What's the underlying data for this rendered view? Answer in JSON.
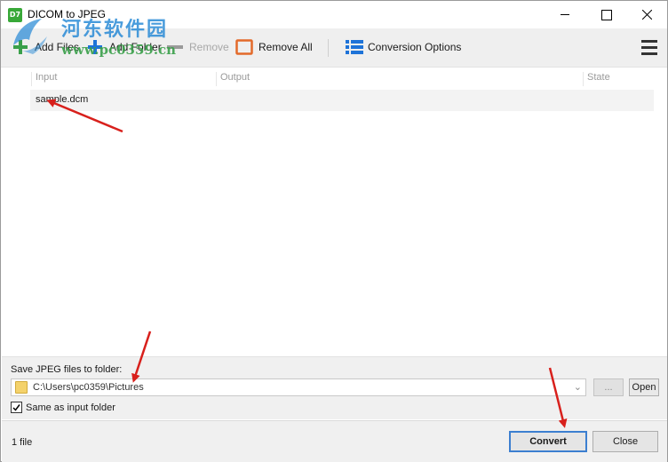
{
  "window": {
    "title": "DICOM to JPEG",
    "icon_text": "D7"
  },
  "watermark": {
    "text_cn": "河东软件园",
    "url": "www.pc0359.cn"
  },
  "toolbar": {
    "add_files": "Add Files",
    "add_folder": "Add Folder",
    "remove": "Remove",
    "remove_all": "Remove All",
    "conversion_options": "Conversion Options"
  },
  "list": {
    "columns": {
      "input": "Input",
      "output": "Output",
      "state": "State"
    },
    "rows": [
      {
        "input": "sample.dcm",
        "output": "",
        "state": ""
      }
    ]
  },
  "output": {
    "label": "Save JPEG files to folder:",
    "path": "C:\\Users\\pc0359\\Pictures",
    "browse_label": "...",
    "open_label": "Open",
    "same_as_input_label": "Same as input folder",
    "same_as_input_checked": true
  },
  "status": {
    "file_count": "1 file",
    "convert_label": "Convert",
    "close_label": "Close"
  },
  "colors": {
    "accent_blue": "#1e73d8",
    "remove_all_orange": "#e36a2a",
    "annotation_red": "#d8201c",
    "add_green": "#3aa04a"
  },
  "icons": {
    "app": "dicom-app-icon",
    "add_files": "plus-icon",
    "add_folder": "plus-icon",
    "remove": "minus-icon",
    "remove_all": "square-outline-icon",
    "conversion_options": "list-options-icon",
    "menu": "hamburger-icon",
    "folder": "folder-icon"
  }
}
